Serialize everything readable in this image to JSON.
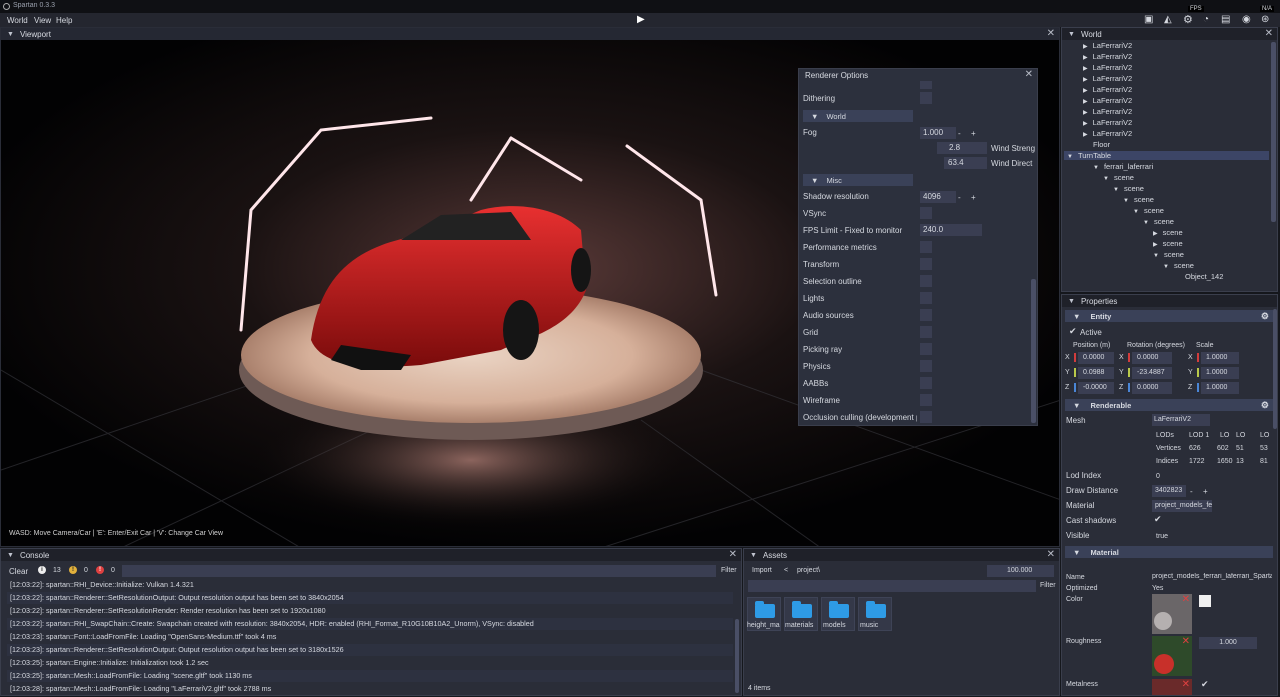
{
  "app": {
    "title": "Spartan 0.3.3"
  },
  "menu": {
    "items": [
      "World",
      "View",
      "Help"
    ]
  },
  "toolbar": {
    "fps_label": "FPS",
    "fps_value": "N/A"
  },
  "viewport": {
    "title": "Viewport",
    "hint": "WASD: Move Camera/Car  |  'E': Enter/Exit Car  |  'V': Change Car View"
  },
  "renderer_options": {
    "title": "Renderer Options",
    "rows_top": [
      "Dithering"
    ],
    "world_section": "World",
    "fog_label": "Fog",
    "fog_value": "1.000",
    "wind_strength_value": "2.8",
    "wind_strength_label": "Wind Streng",
    "wind_direction_value": "63.4",
    "wind_direction_label": "Wind Direct",
    "misc_section": "Misc",
    "shadow_resolution_label": "Shadow resolution",
    "shadow_resolution_value": "4096",
    "vsync_label": "VSync",
    "fps_limit_label": "FPS Limit - Fixed to monitor",
    "fps_limit_value": "240.0",
    "toggles": [
      "Performance metrics",
      "Transform",
      "Selection outline",
      "Lights",
      "Audio sources",
      "Grid",
      "Picking ray",
      "Physics",
      "AABBs",
      "Wireframe",
      "Occlusion culling (development purp"
    ],
    "minus": "-",
    "plus": "+"
  },
  "world_panel": {
    "title": "World",
    "items": [
      {
        "label": "LaFerrariV2",
        "arrow": "▶"
      },
      {
        "label": "LaFerrariV2",
        "arrow": "▶"
      },
      {
        "label": "LaFerrariV2",
        "arrow": "▶"
      },
      {
        "label": "LaFerrariV2",
        "arrow": "▶"
      },
      {
        "label": "LaFerrariV2",
        "arrow": "▶"
      },
      {
        "label": "LaFerrariV2",
        "arrow": "▶"
      },
      {
        "label": "LaFerrariV2",
        "arrow": "▶"
      },
      {
        "label": "LaFerrariV2",
        "arrow": "▶"
      },
      {
        "label": "LaFerrariV2",
        "arrow": "▶"
      },
      {
        "label": "Floor",
        "arrow": ""
      },
      {
        "label": "TurnTable",
        "arrow": "▼"
      },
      {
        "label": "ferrari_laferrari",
        "arrow": "▼"
      },
      {
        "label": "scene",
        "arrow": "▼"
      },
      {
        "label": "scene",
        "arrow": "▼"
      },
      {
        "label": "scene",
        "arrow": "▼"
      },
      {
        "label": "scene",
        "arrow": "▼"
      },
      {
        "label": "scene",
        "arrow": "▼"
      },
      {
        "label": "scene",
        "arrow": "▶"
      },
      {
        "label": "scene",
        "arrow": "▶"
      },
      {
        "label": "scene",
        "arrow": "▼"
      },
      {
        "label": "scene",
        "arrow": "▼"
      },
      {
        "label": "Object_142",
        "arrow": ""
      }
    ]
  },
  "properties": {
    "title": "Properties",
    "entity_section": "Entity",
    "active_label": "Active",
    "position_label": "Position (m)",
    "rotation_label": "Rotation (degrees)",
    "scale_label": "Scale",
    "position": [
      "0.0000",
      "0.0988",
      "-0.0000"
    ],
    "rotation": [
      "0.0000",
      "-23.4887",
      "0.0000"
    ],
    "scale": [
      "1.0000",
      "1.0000",
      "1.0000"
    ],
    "axes": [
      "X",
      "Y",
      "Z"
    ],
    "renderable_section": "Renderable",
    "mesh_label": "Mesh",
    "mesh_value": "LaFerrariV2",
    "lod_header": [
      "LODs",
      "LOD 1",
      "LO",
      "LO",
      "LO"
    ],
    "lod_vertices": [
      "Vertices",
      "626",
      "602",
      "51",
      "53"
    ],
    "lod_indices": [
      "Indices",
      "1722",
      "1650",
      "13",
      "81"
    ],
    "lod_index_label": "Lod Index",
    "lod_index_value": "0",
    "draw_distance_label": "Draw Distance",
    "draw_distance_value": "3402823",
    "material_label": "Material",
    "material_value": "project_models_fe",
    "cast_shadows_label": "Cast shadows",
    "visible_label": "Visible",
    "visible_value": "true",
    "material_section": "Material",
    "name_label": "Name",
    "name_value": "project_models_ferrari_laferrari_Sparta",
    "optimized_label": "Optimized",
    "optimized_value": "Yes",
    "color_label": "Color",
    "roughness_label": "Roughness",
    "roughness_value": "1.000",
    "metalness_label": "Metalness"
  },
  "console": {
    "title": "Console",
    "clear_label": "Clear",
    "info_count": "13",
    "warning_count": "0",
    "error_count": "0",
    "filter_label": "Filter",
    "lines": [
      "[12:03:22]: spartan::RHI_Device::Initialize: Vulkan 1.4.321",
      "[12:03:22]: spartan::Renderer::SetResolutionOutput: Output resolution output has been set to 3840x2054",
      "[12:03:22]: spartan::Renderer::SetResolutionRender: Render resolution has been set to 1920x1080",
      "[12:03:22]: spartan::RHI_SwapChain::Create: Swapchain created with resolution: 3840x2054, HDR: enabled (RHI_Format_R10G10B10A2_Unorm), VSync: disabled",
      "[12:03:23]: spartan::Font::LoadFromFile: Loading \"OpenSans-Medium.ttf\" took 4 ms",
      "[12:03:23]: spartan::Renderer::SetResolutionOutput: Output resolution output has been set to 3180x1526",
      "[12:03:25]: spartan::Engine::Initialize: Initialization took 1.2 sec",
      "[12:03:25]: spartan::Mesh::LoadFromFile: Loading \"scene.gltf\" took 1130 ms",
      "[12:03:28]: spartan::Mesh::LoadFromFile: Loading \"LaFerrariV2.gltf\" took 2788 ms"
    ]
  },
  "assets": {
    "title": "Assets",
    "import_label": "Import",
    "back_label": "<",
    "path": "project\\",
    "zoom": "100.000",
    "filter_label": "Filter",
    "folders": [
      "height_ma",
      "materials",
      "models",
      "music"
    ],
    "count": "4 items"
  },
  "colors": {
    "accent": "#2e9be6",
    "panel": "#2a2d38",
    "section": "#3a4158",
    "selection": "#3c4566"
  }
}
